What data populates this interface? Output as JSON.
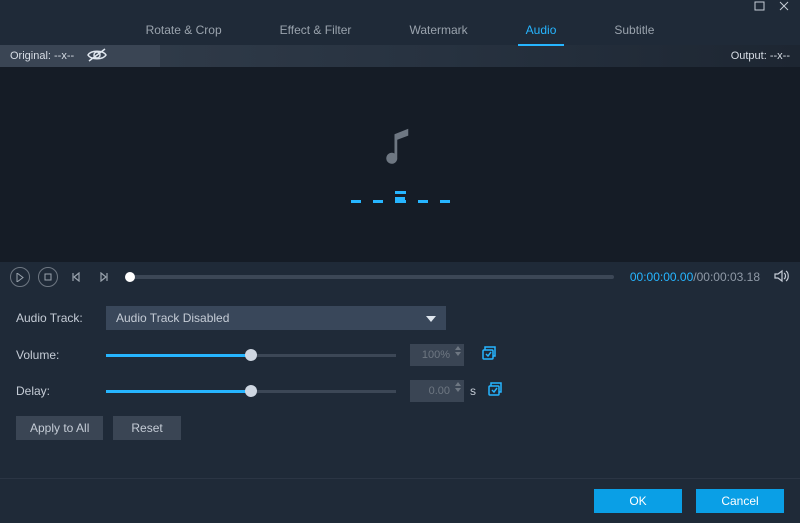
{
  "window": {},
  "tabs": {
    "rotate": "Rotate & Crop",
    "effect": "Effect & Filter",
    "watermark": "Watermark",
    "audio": "Audio",
    "subtitle": "Subtitle"
  },
  "infobar": {
    "original_label": "Original: --x--",
    "output_label": "Output: --x--"
  },
  "transport": {
    "current": "00:00:00.00",
    "separator": "/",
    "total": "00:00:03.18"
  },
  "controls": {
    "audio_track_label": "Audio Track:",
    "audio_track_value": "Audio Track Disabled",
    "volume_label": "Volume:",
    "volume_value": "100%",
    "delay_label": "Delay:",
    "delay_value": "0.00",
    "delay_unit": "s",
    "apply_to_all": "Apply to All",
    "reset": "Reset"
  },
  "footer": {
    "ok": "OK",
    "cancel": "Cancel"
  }
}
